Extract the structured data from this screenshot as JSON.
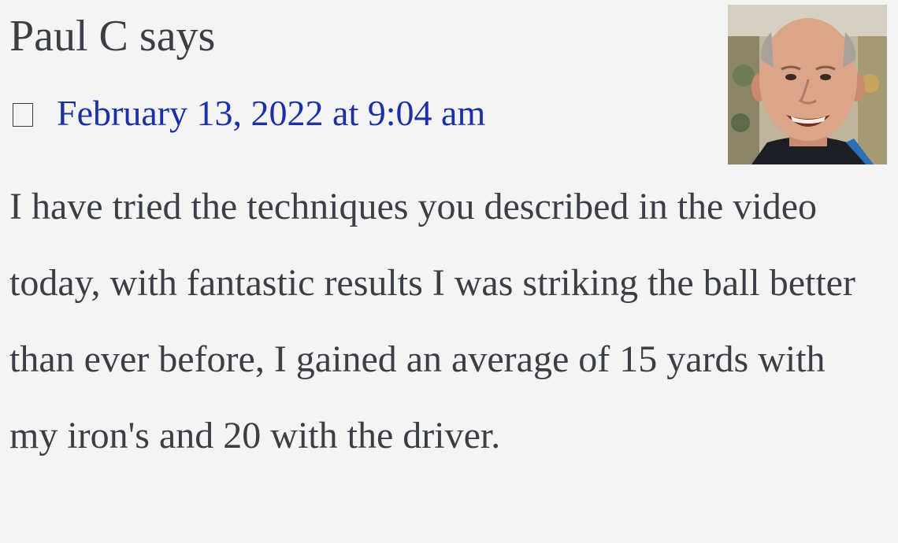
{
  "comment": {
    "author_line": "Paul C says",
    "date_text": "February 13, 2022 at 9:04 am",
    "date_icon": "clock-icon",
    "avatar_icon": "avatar-photo",
    "body": "I have tried the techniques you described in the video today, with fantastic results I was striking the ball better than ever before, I gained an average of 15 yards with my iron's and 20 with the driver.",
    "colors": {
      "background": "#f4f4f5",
      "text": "#3b3f45",
      "link": "#1a2fa8"
    }
  }
}
